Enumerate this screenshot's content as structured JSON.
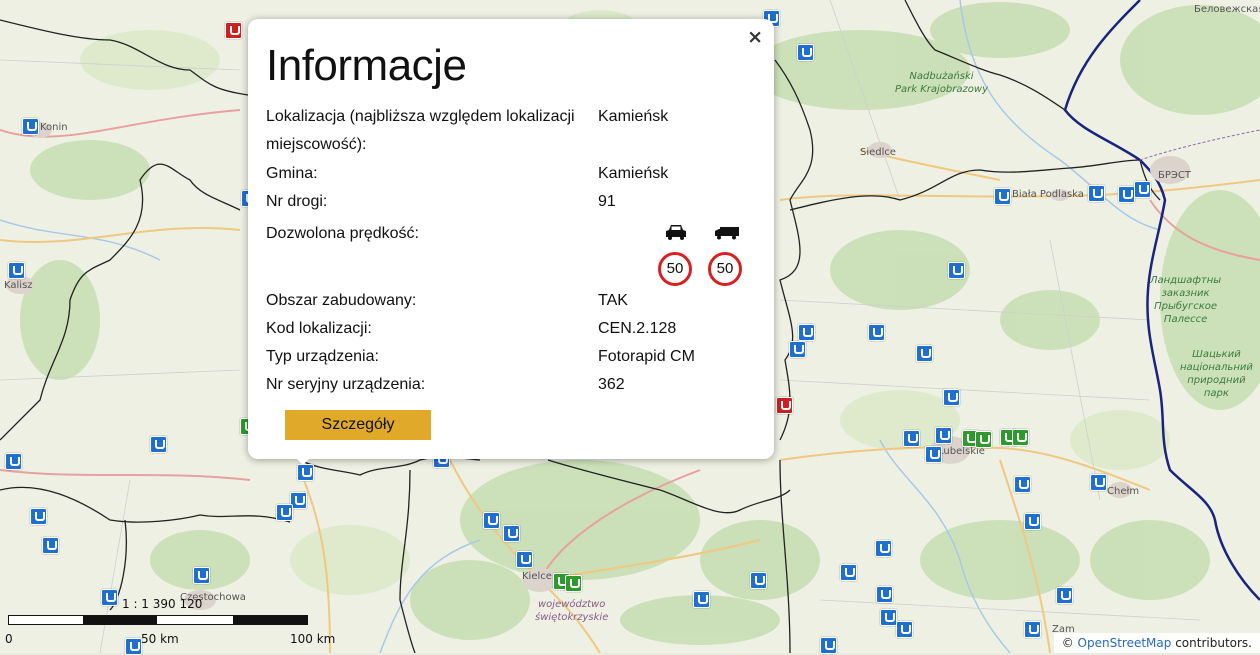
{
  "map": {
    "place_labels": [
      {
        "id": "bialowieska",
        "text": "Беловежская"
      },
      {
        "id": "konin",
        "text": "Konin"
      },
      {
        "id": "nadbuzanski",
        "text": "Nadbużański\nPark Krajobrazowy"
      },
      {
        "id": "siedlce",
        "text": "Siedlce"
      },
      {
        "id": "biala",
        "text": "Biała Podlaska"
      },
      {
        "id": "brest",
        "text": "БРЭСТ"
      },
      {
        "id": "kalisz",
        "text": "Kalisz"
      },
      {
        "id": "zakaznik",
        "text": "Ландшафтны\nзаказник\nПрыбугское\nПалессе"
      },
      {
        "id": "shatsky",
        "text": "Шацький\nнаціональний\nприродний\nпарк"
      },
      {
        "id": "lubelskie",
        "text": "Lubelskie"
      },
      {
        "id": "chelm",
        "text": "Chełm"
      },
      {
        "id": "czestochowa",
        "text": "Częstochowa"
      },
      {
        "id": "kielce",
        "text": "Kielce"
      },
      {
        "id": "swietokrzyskie",
        "text": "województwo\nświętokrzyskie"
      },
      {
        "id": "zamosc",
        "text": "Zam"
      }
    ]
  },
  "popup": {
    "title": "Informacje",
    "close_glyph": "×",
    "rows": [
      {
        "label": "Lokalizacja (najbliższa względem lokalizacji",
        "label2": "miejscowość):",
        "value": "Kamieńsk"
      },
      {
        "label": "Gmina:",
        "value": "Kamieńsk"
      },
      {
        "label": "Nr drogi:",
        "value": "91"
      },
      {
        "label": "Dozwolona prędkość:"
      },
      {
        "label": "Obszar zabudowany:",
        "value": "TAK"
      },
      {
        "label": "Kod lokalizacji:",
        "value": "CEN.2.128"
      },
      {
        "label": "Typ urządzenia:",
        "value": "Fotorapid CM"
      },
      {
        "label": "Nr seryjny urządzenia:",
        "value": "362"
      }
    ],
    "speed": {
      "car_icon": "car-icon",
      "truck_icon": "truck-icon",
      "car_limit": "50",
      "truck_limit": "50"
    },
    "details_button": "Szczegóły"
  },
  "scale": {
    "ratio": "1 : 1 390 120",
    "mid_label": "50 km",
    "end_label": "100 km"
  },
  "attribution": {
    "prefix": "© ",
    "link": "OpenStreetMap",
    "suffix": " contributors."
  },
  "colors": {
    "pin_blue": "#1f6fd1",
    "pin_green": "#2e9a2e",
    "pin_red": "#cc2020",
    "button": "#e0a92a",
    "border_country": "#1a237e"
  }
}
